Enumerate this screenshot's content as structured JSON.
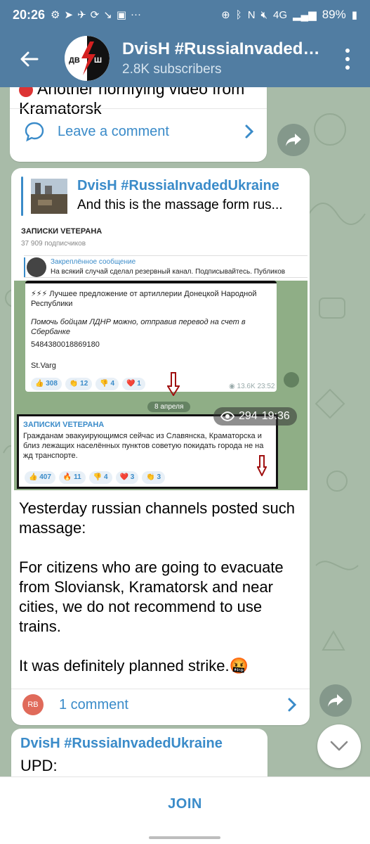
{
  "status_bar": {
    "time": "20:26",
    "battery": "89%",
    "left_icons": [
      "settings-icon",
      "navigation-icon",
      "telegram-icon",
      "sync-icon",
      "missed-call-icon",
      "image-icon",
      "more-icon"
    ],
    "right_icons": [
      "location-icon",
      "bluetooth-icon",
      "nfc-icon",
      "mute-icon",
      "lte-icon",
      "signal-icon",
      "battery-icon"
    ],
    "more_label": "···"
  },
  "header": {
    "title": "DvisH #RussiaInvadedUkraine",
    "subtitle": "2.8K subscribers",
    "avatar_text": "ДВ Ш"
  },
  "messages": [
    {
      "text": "Another horrifying video from Kramatorsk",
      "emoji_icon": "red-circle-icon",
      "comment_label": "Leave a comment"
    },
    {
      "reply": {
        "name": "DvisH #RussiaInvadedUkraine",
        "text": "And this is the massage form rus..."
      },
      "screenshot": {
        "channel_name": "ЗАПИСКИ VETEPAHA",
        "subscribers": "37 909 подписчиков",
        "pinned_title": "Закреплённое сообщение",
        "pinned_text": "На всякий случай сделал резервный канал. Подписывайтесь. Публиков",
        "post1_line1": "⚡⚡⚡ Лучшее предложение от артиллерии Донецкой Народной Республики",
        "post1_line2": "Помочь бойцам ЛДНР можно, отправив перевод на счет в Сбербанке",
        "post1_number": "5484380018869180",
        "post1_sign": "St.Varg",
        "post1_reactions": [
          "👍 308",
          "👏 12",
          "👎 4",
          "❤️ 1"
        ],
        "post1_views": "13.6K",
        "post1_time": "23:52",
        "date_chip": "8 апреля",
        "post2_name": "ЗАПИСКИ VETEPAHA",
        "post2_text": "Гражданам эвакуирующимся сейчас из Славянска, Краматорска и близ лежащих населённых пунктов советую покидать города не на жд транспорте.",
        "post2_reactions": [
          "👍 407",
          "🔥 11",
          "👎 4",
          "❤️ 3",
          "👏 3"
        ],
        "views": "294",
        "time": "19:36"
      },
      "paragraphs": [
        "Yesterday russian channels posted such massage:",
        "For citizens who are going to evacuate from Sloviansk, Kramatorsk and near cities, we do not recommend to use trains.",
        "It was definitely planned strike.🤬"
      ],
      "commenter_initials": "RB",
      "comment_label": "1 comment"
    },
    {
      "name": "DvisH #RussiaInvadedUkraine",
      "text": "UPD:"
    }
  ],
  "footer": {
    "join_label": "JOIN"
  },
  "colors": {
    "header": "#517da2",
    "accent": "#3a8bc9",
    "background": "#a8bba8"
  }
}
